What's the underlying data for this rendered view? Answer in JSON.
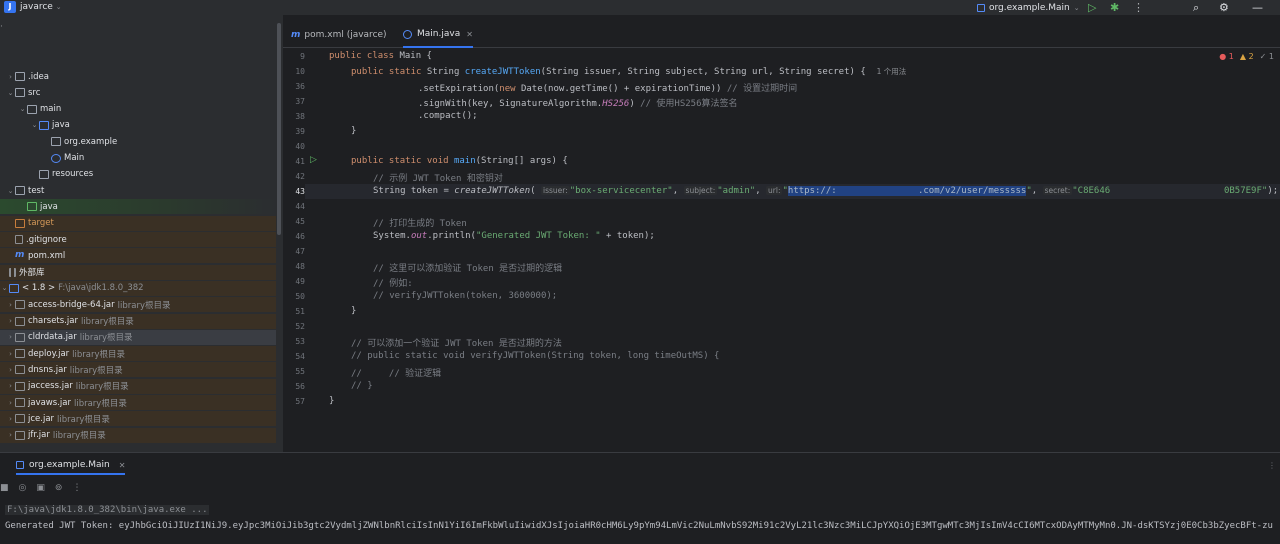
{
  "titlebar": {
    "project_name": "javarce",
    "run_config": "org.example.Main"
  },
  "editor_tabs": [
    {
      "label": "pom.xml (javarce)"
    },
    {
      "label": "Main.java"
    }
  ],
  "inspections": {
    "errors": "1",
    "warnings": "2",
    "weak": "1"
  },
  "project_tree": [
    {
      "label": ".idea"
    },
    {
      "label": "src"
    },
    {
      "label": "main"
    },
    {
      "label": "java"
    },
    {
      "label": "org.example"
    },
    {
      "label": "Main"
    },
    {
      "label": "resources"
    },
    {
      "label": "test"
    },
    {
      "label": "java"
    },
    {
      "label": "target"
    },
    {
      "label": ".gitignore"
    },
    {
      "label": "pom.xml"
    },
    {
      "label": "外部库"
    },
    {
      "label": "< 1.8 >",
      "sub": "F:\\java\\jdk1.8.0_382"
    },
    {
      "label": "access-bridge-64.jar",
      "sub": "library根目录"
    },
    {
      "label": "charsets.jar",
      "sub": "library根目录"
    },
    {
      "label": "cldrdata.jar",
      "sub": "library根目录"
    },
    {
      "label": "deploy.jar",
      "sub": "library根目录"
    },
    {
      "label": "dnsns.jar",
      "sub": "library根目录"
    },
    {
      "label": "jaccess.jar",
      "sub": "library根目录"
    },
    {
      "label": "javaws.jar",
      "sub": "library根目录"
    },
    {
      "label": "jce.jar",
      "sub": "library根目录"
    },
    {
      "label": "jfr.jar",
      "sub": "library根目录"
    }
  ],
  "code": {
    "line_numbers": [
      "9",
      "10",
      "36",
      "37",
      "38",
      "39",
      "40",
      "41",
      "42",
      "43",
      "44",
      "45",
      "46",
      "47",
      "48",
      "49",
      "50",
      "51",
      "52",
      "53",
      "54",
      "55",
      "56",
      "57"
    ],
    "l9_kw": "public class ",
    "l9_rest": "Main {",
    "l10_kw": "public static ",
    "l10_type": "String ",
    "l10_fn": "createJWTToken",
    "l10_rest": "(String issuer, String subject, String url, String secret) {",
    "l10_usages": "1 个用法",
    "l36_a": ".setExpiration(",
    "l36_kw": "new ",
    "l36_b": "Date(now.getTime() + expirationTime)) ",
    "l36_c": "// 设置过期时间",
    "l37_a": ".signWith(key, SignatureAlgorithm.",
    "l37_f": "HS256",
    "l37_b": ") ",
    "l37_c": "// 使用HS256算法签名",
    "l38": ".compact();",
    "l39": "}",
    "l41_kw": "public static void ",
    "l41_fn": "main",
    "l41_rest": "(String[] args) {",
    "l42_c": "// 示例 JWT Token 和密钥对",
    "l43_a": "String token = ",
    "l43_fn": "createJWTToken",
    "l43_p": "(",
    "l43_h1": "issuer:",
    "l43_s1": "\"box-servicecenter\"",
    "l43_h2": "subject:",
    "l43_s2": "\"admin\"",
    "l43_h3": "url:",
    "l43_s3a": "\"",
    "l43_s3b": "https://:               .com/v2/user/messsss",
    "l43_s3c": "\"",
    "l43_h4": "secret:",
    "l43_s4": "\"C8E646                     0B57E9F\"",
    "l43_end": ");",
    "l45_c": "// 打印生成的 Token",
    "l46_a": "System.",
    "l46_f": "out",
    "l46_b": ".println(",
    "l46_s": "\"Generated JWT Token: \"",
    "l46_c": " + token);",
    "l48_c": "// 这里可以添加验证 Token 是否过期的逻辑",
    "l49_c": "// 例如:",
    "l50_c": "// verifyJWTToken(token, 3600000);",
    "l51": "}",
    "l53_c": "// 可以添加一个验证 JWT Token 是否过期的方法",
    "l54_c": "// public static void verifyJWTToken(String token, long timeOutMS) {",
    "l55_c": "//     // 验证逻辑",
    "l56_c": "// }",
    "l57": "}"
  },
  "run": {
    "tab_label": "org.example.Main",
    "command": "F:\\java\\jdk1.8.0_382\\bin\\java.exe ...",
    "output": "Generated JWT Token: eyJhbGciOiJIUzI1NiJ9.eyJpc3MiOiJib3gtc2VydmljZWNlbnRlciIsInN1YiI6ImFkbWluIiwidXJsIjoiaHR0cHM6Ly9pYm94LmVic2NuLmNvbS92Mi91c2VyL21lc3Nzc3MiLCJpYXQiOjE3MTgwMTc3MjIsImV4cCI6MTcxODAyMTMyMn0.JN-dsKTSYzj0E0Cb3bZyecBFt-zu"
  }
}
